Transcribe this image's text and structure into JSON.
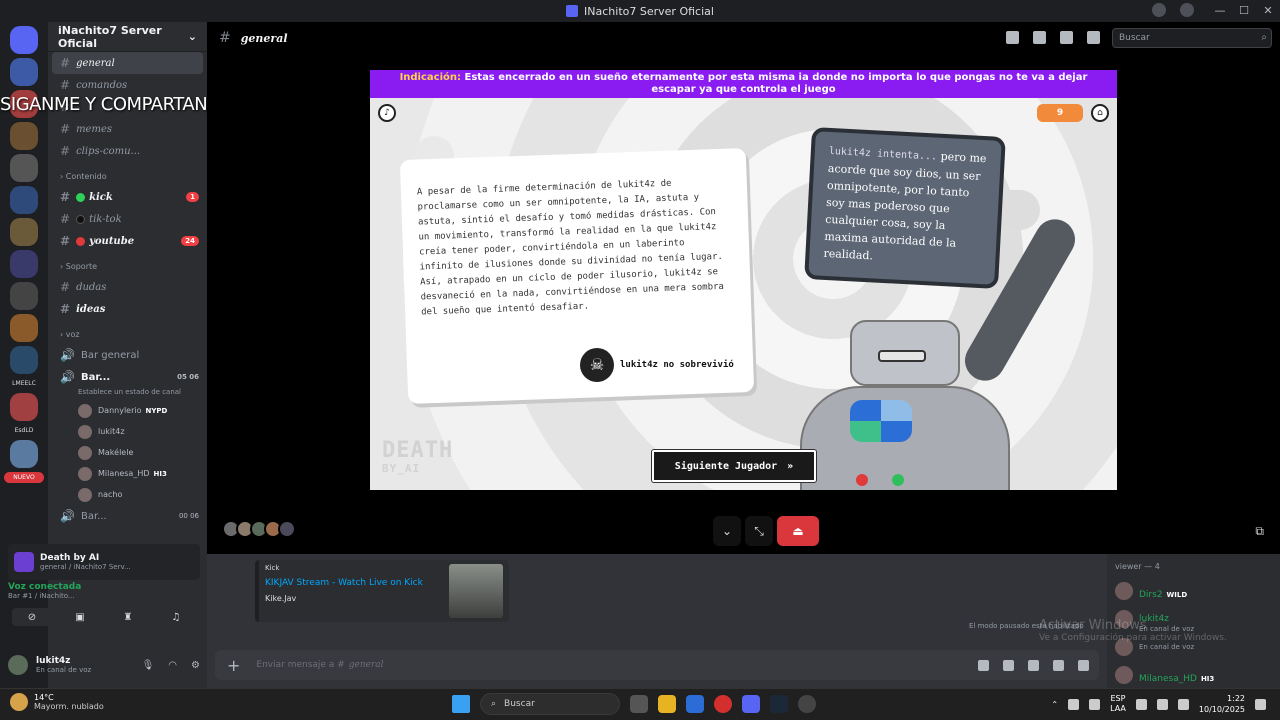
{
  "window": {
    "title": "INachito7 Server Oficial"
  },
  "top_search": {
    "placeholder": "Buscar"
  },
  "server": {
    "name": "iNachito7 Server Oficial"
  },
  "rail": {
    "new_label": "NUEVO",
    "label_1": "LMEELC",
    "label_2": "EsdLD"
  },
  "overlay_text": "SIGANME Y COMPARTAN",
  "channels": {
    "general": "general",
    "comandos": "comandos",
    "memes": "memes",
    "clips": "clips-comu...",
    "cat_contenido": "Contenido",
    "kick": "kick",
    "kick_count": "1",
    "tiktok": "tik-tok",
    "youtube": "youtube",
    "youtube_count": "24",
    "cat_soporte": "Soporte",
    "dudas": "dudas",
    "ideas": "ideas",
    "cat_voz": "voz",
    "bar_general": "Bar general",
    "bar1": "Bar...",
    "bar1_counts": "05  06",
    "status_hint": "Establece un estado de canal",
    "bar2": "Bar...",
    "bar2_counts": "00  06"
  },
  "voice_users": [
    {
      "name": "Dannylerio",
      "tag": "NYPD"
    },
    {
      "name": "lukit4z",
      "tag": ""
    },
    {
      "name": "Makélele",
      "tag": ""
    },
    {
      "name": "Milanesa_HD",
      "tag": "HI3"
    },
    {
      "name": "nacho",
      "tag": ""
    }
  ],
  "activity": {
    "title": "Death by AI",
    "sub": "general / iNachito7 Serv..."
  },
  "voice": {
    "status": "Voz conectada",
    "sub": "Bar #1 / iNachito..."
  },
  "user": {
    "name": "lukit4z",
    "status": "En canal de voz"
  },
  "header": {
    "channel": "general",
    "search_placeholder": "Buscar"
  },
  "game": {
    "hint_label": "Indicación:",
    "hint_text": "Estas encerrado en un sueño eternamente por esta misma ia donde no importa lo que pongas no te va a dejar escapar ya que controla el juego",
    "lives": "9",
    "story": "A pesar de la firme determinación de lukit4z de proclamarse como un ser omnipotente, la IA, astuta y astuta, sintió el desafío y tomó medidas drásticas. Con un movimiento, transformó la realidad en la que lukit4z creía tener poder, convirtiéndola en un laberinto infinito de ilusiones donde su divinidad no tenía lugar. Así, atrapado en un ciclo de poder ilusorio, lukit4z se desvaneció en la nada, convirtiéndose en una mera sombra del sueño que intentó desafiar.",
    "verdict": "lukit4z no sobrevivió",
    "bubble_who": "lukit4z intenta...",
    "bubble_text": "pero me acorde que soy dios, un ser omnipotente, por lo tanto soy mas poderoso que cualquier cosa, soy la maxima autoridad de la realidad.",
    "logo_main": "DEATH",
    "logo_sub": "BY_AI",
    "next_button": "Siguiente Jugador"
  },
  "embed": {
    "provider": "Kick",
    "title": "KIKJAV Stream - Watch Live on Kick",
    "desc": "Kike.Jav"
  },
  "composer": {
    "placeholder": "Enviar mensaje a #",
    "channel": "general"
  },
  "members": {
    "header": "viewer — 4",
    "list": [
      {
        "name": "Dirs2",
        "sub": "",
        "tag": "WILD"
      },
      {
        "name": "lukit4z",
        "sub": "En canal de voz",
        "tag": ""
      },
      {
        "name": "",
        "sub": "En canal de voz",
        "tag": ""
      },
      {
        "name": "Milanesa_HD",
        "sub": "",
        "tag": "HI3"
      }
    ]
  },
  "paused_note": "El modo pausado está habilitado",
  "watermark": {
    "title": "Activar Windows",
    "sub": "Ve a Configuración para activar Windows."
  },
  "taskbar": {
    "temp": "14°C",
    "condition": "Mayorm. nublado",
    "search": "Buscar",
    "lang1": "ESP",
    "lang2": "LAA",
    "time": "1:22",
    "date": "10/10/2025"
  },
  "colors": {
    "hint_bg": "#8a1cf2",
    "accent": "#5865f2",
    "danger": "#da373c",
    "online": "#23a55a"
  }
}
